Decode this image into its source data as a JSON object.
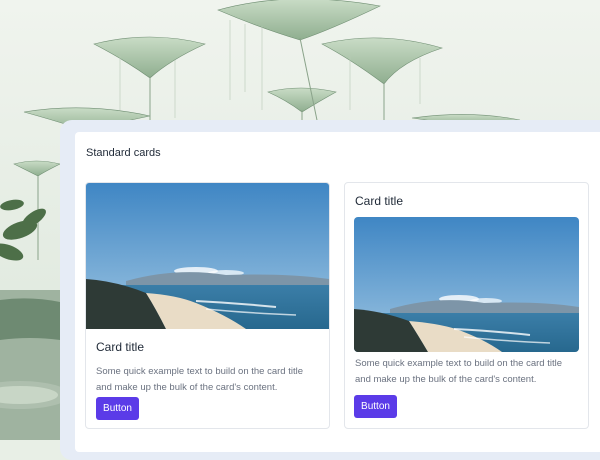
{
  "section": {
    "title": "Standard cards"
  },
  "cards": [
    {
      "title": "Card title",
      "text": "Some quick example text to build on the card title and make up the bulk of the card's content.",
      "button_label": "Button",
      "image": "coastal-landscape"
    },
    {
      "title": "Card title",
      "text": "Some quick example text to build on the card title and make up the bulk of the card's content.",
      "button_label": "Button",
      "image": "coastal-landscape"
    }
  ],
  "colors": {
    "accent": "#5b3be8",
    "panel": "#e6ecf6",
    "card_border": "#e3e6eb",
    "text_muted": "#6b7280"
  }
}
